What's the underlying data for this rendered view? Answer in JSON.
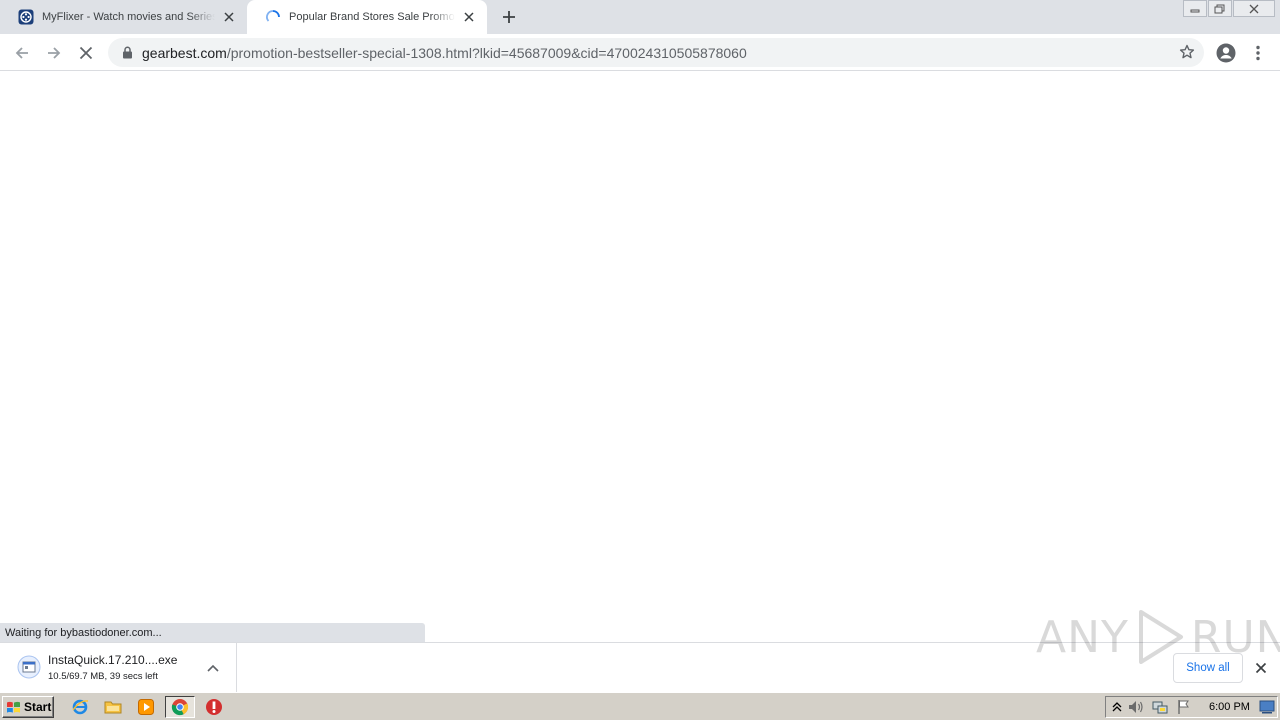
{
  "tabs": [
    {
      "title": "MyFlixer - Watch movies and Series Online Free",
      "favicon": "film-reel-icon",
      "active": false
    },
    {
      "title": "Popular Brand Stores Sale Promotion | GearBest",
      "favicon": "loading-spinner-icon",
      "active": true
    }
  ],
  "address_bar": {
    "host": "gearbest.com",
    "path": "/promotion-bestseller-special-1308.html?lkid=45687009&cid=470024310505878060"
  },
  "status_bubble": "Waiting for bybastiodoner.com...",
  "download": {
    "filename": "InstaQuick.17.210....exe",
    "status": "10.5/69.7 MB, 39 secs left"
  },
  "show_all_label": "Show all",
  "watermark": {
    "text_left": "ANY",
    "text_right": "RUN"
  },
  "taskbar": {
    "start_label": "Start",
    "clock": "6:00 PM"
  },
  "colors": {
    "tabstrip": "#dee1e6",
    "accent": "#1a73e8",
    "taskbar": "#d4d0c8"
  }
}
